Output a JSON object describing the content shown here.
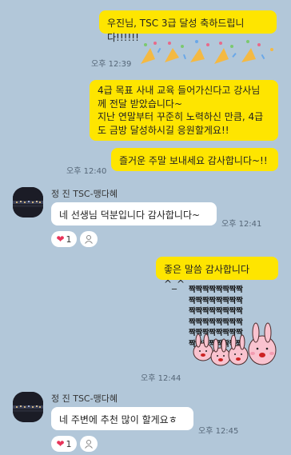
{
  "messages": {
    "m1": {
      "text": "우진님, TSC 3급 달성 축하드립니다!!!!!!",
      "time": "오후 12:39"
    },
    "m2": {
      "line1": "4급 목표 사내 교육 들어가신다고 강사님",
      "line2": "께 전달 받았습니다~",
      "line3": "지난 연말부터 꾸준히 노력하신 만큼, 4급",
      "line4": "도 금방 달성하시길 응원할게요!!"
    },
    "m3": {
      "text": "즐거운 주말 보내세요 감사합니다~!!",
      "time": "오후 12:40"
    },
    "other1": {
      "sender": "정  진 TSC-맹다혜",
      "text": "네 선생님 덕분입니다 감사합니다~",
      "time": "오후 12:41",
      "reaction_count": "1"
    },
    "m4": {
      "text": "좋은 말씀 감사합니다^_^"
    },
    "sticker": {
      "text": "짝",
      "time": "오후 12:44"
    },
    "other2": {
      "sender": "정  진 TSC-맹다혜",
      "text": "네 주변에 추천 많이 할게요ㅎ",
      "time": "오후 12:45",
      "reaction_count": "1"
    }
  },
  "colors": {
    "background": "#b2c7d9",
    "my_bubble": "#fee500",
    "other_bubble": "#ffffff",
    "heart": "#e8345a"
  }
}
